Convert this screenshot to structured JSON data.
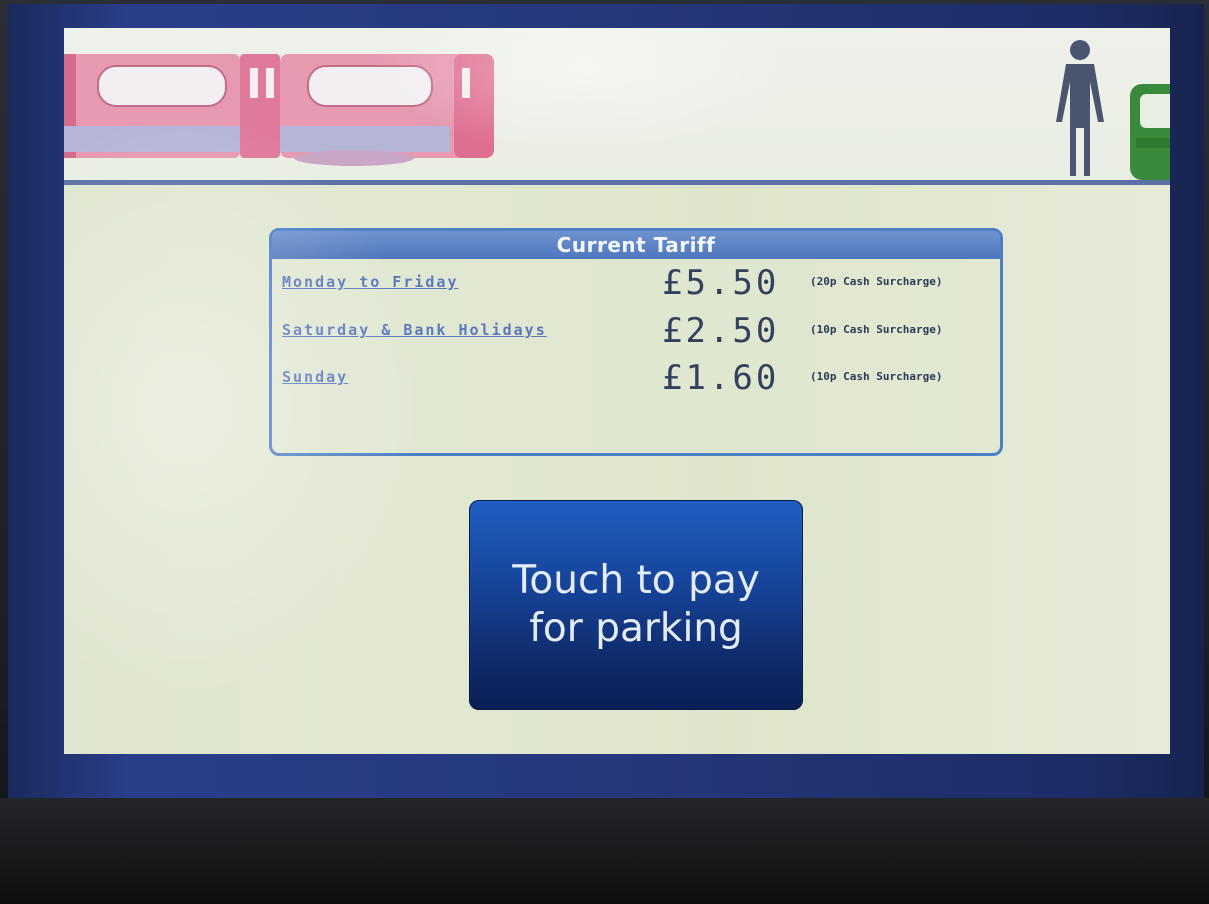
{
  "tariff": {
    "title": "Current Tariff",
    "rows": [
      {
        "day": "Monday to Friday",
        "price": "£5.50",
        "surcharge": "(20p Cash Surcharge)"
      },
      {
        "day": "Saturday & Bank Holidays",
        "price": "£2.50",
        "surcharge": "(10p Cash Surcharge)"
      },
      {
        "day": "Sunday",
        "price": "£1.60",
        "surcharge": "(10p Cash Surcharge)"
      }
    ]
  },
  "pay_button": {
    "label": "Touch to pay\nfor parking"
  },
  "header": {
    "icons": [
      "train-icon",
      "person-icon",
      "car-icon"
    ]
  },
  "colors": {
    "screen_background": "#e2e8d2",
    "tariff_border": "#4c7fc4",
    "day_text": "#5b78bf",
    "price_text": "#33405e",
    "button": "#17449a",
    "train": "#e07a9a"
  }
}
